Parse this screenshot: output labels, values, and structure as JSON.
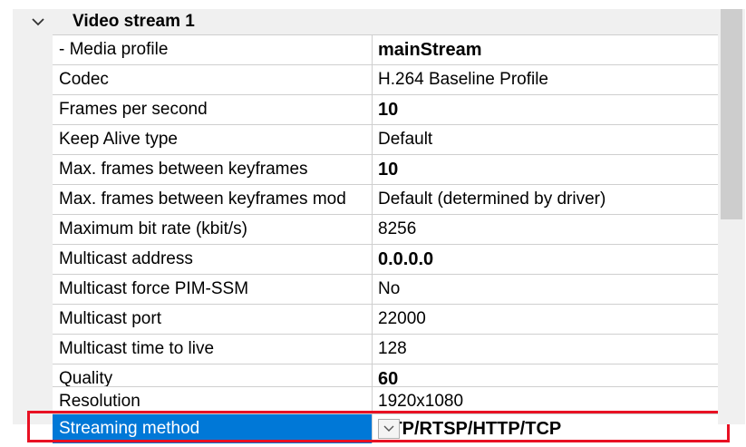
{
  "category": {
    "title": "Video stream 1",
    "icon": "chevron-down-icon"
  },
  "rows": [
    {
      "name": "- Media profile",
      "value": "mainStream",
      "bold": true
    },
    {
      "name": "Codec",
      "value": "H.264 Baseline Profile",
      "bold": false
    },
    {
      "name": "Frames per second",
      "value": "10",
      "bold": true
    },
    {
      "name": "Keep Alive type",
      "value": "Default",
      "bold": false
    },
    {
      "name": "Max. frames between keyframes",
      "value": "10",
      "bold": true
    },
    {
      "name": "Max. frames between keyframes mod",
      "value": "Default (determined by driver)",
      "bold": false
    },
    {
      "name": "Maximum bit rate (kbit/s)",
      "value": "8256",
      "bold": false
    },
    {
      "name": "Multicast address",
      "value": "0.0.0.0",
      "bold": true
    },
    {
      "name": "Multicast force PIM-SSM",
      "value": "No",
      "bold": false
    },
    {
      "name": "Multicast port",
      "value": "22000",
      "bold": false
    },
    {
      "name": "Multicast time to live",
      "value": "128",
      "bold": false
    },
    {
      "name": "Quality",
      "value": "60",
      "bold": true
    },
    {
      "name": "Resolution",
      "value": "1920x1080",
      "bold": false
    },
    {
      "name": "Streaming method",
      "value": "RTP/RTSP/HTTP/TCP",
      "bold": true
    }
  ],
  "colors": {
    "selection": "#0078d7",
    "highlight": "#e81123"
  }
}
